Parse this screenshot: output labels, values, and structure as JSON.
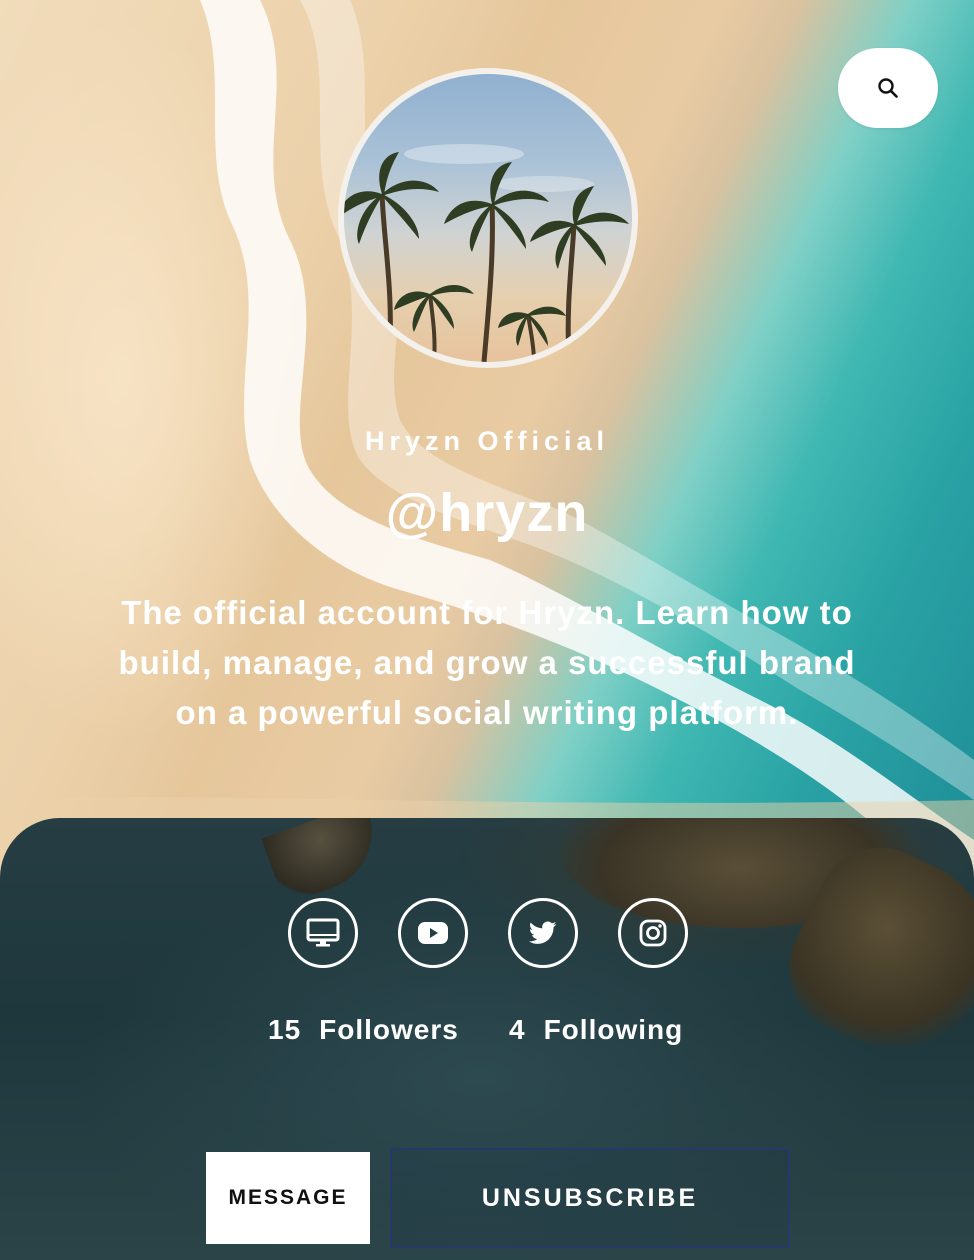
{
  "profile": {
    "display_name": "Hryzn Official",
    "handle": "@hryzn",
    "bio": "The official account for Hryzn. Learn how to build, manage, and grow a successful brand on a powerful social writing platform."
  },
  "header": {
    "search_icon": "search-icon"
  },
  "socials": [
    {
      "name": "website",
      "icon": "monitor-icon"
    },
    {
      "name": "youtube",
      "icon": "youtube-icon"
    },
    {
      "name": "twitter",
      "icon": "twitter-icon"
    },
    {
      "name": "instagram",
      "icon": "instagram-icon"
    }
  ],
  "stats": {
    "followers_count": "15",
    "followers_label": "Followers",
    "following_count": "4",
    "following_label": "Following"
  },
  "actions": {
    "message_label": "MESSAGE",
    "unsubscribe_label": "UNSUBSCRIBE"
  },
  "colors": {
    "text": "#ffffff",
    "unsubscribe_border": "#263a6a",
    "message_bg": "#ffffff"
  }
}
